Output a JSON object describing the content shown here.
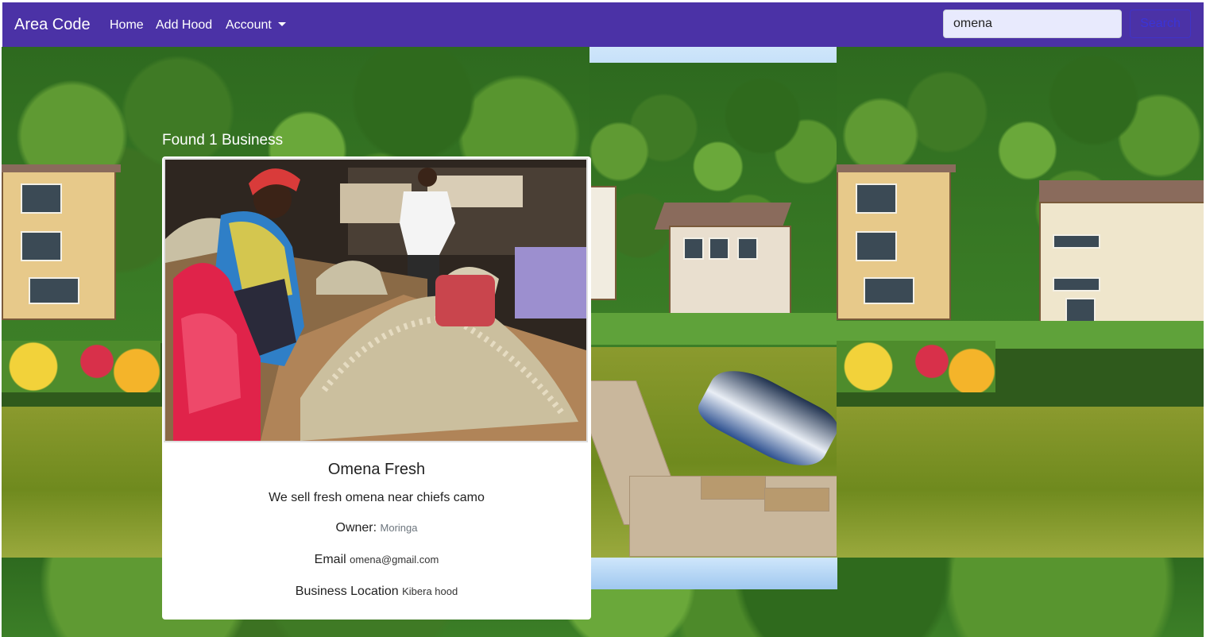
{
  "navbar": {
    "brand": "Area Code",
    "links": [
      "Home",
      "Add Hood"
    ],
    "account_label": "Account",
    "search_value": "omena",
    "search_button": "Search"
  },
  "results": {
    "heading": "Found 1 Business"
  },
  "business": {
    "name": "Omena Fresh",
    "description": "We sell fresh omena near chiefs camo",
    "owner_label": "Owner:",
    "owner": "Moringa",
    "email_label": "Email",
    "email": "omena@gmail.com",
    "location_label": "Business Location",
    "location": "Kibera hood"
  },
  "colors": {
    "navbar": "#4b32a6",
    "search_button_text": "#3a34d8"
  }
}
